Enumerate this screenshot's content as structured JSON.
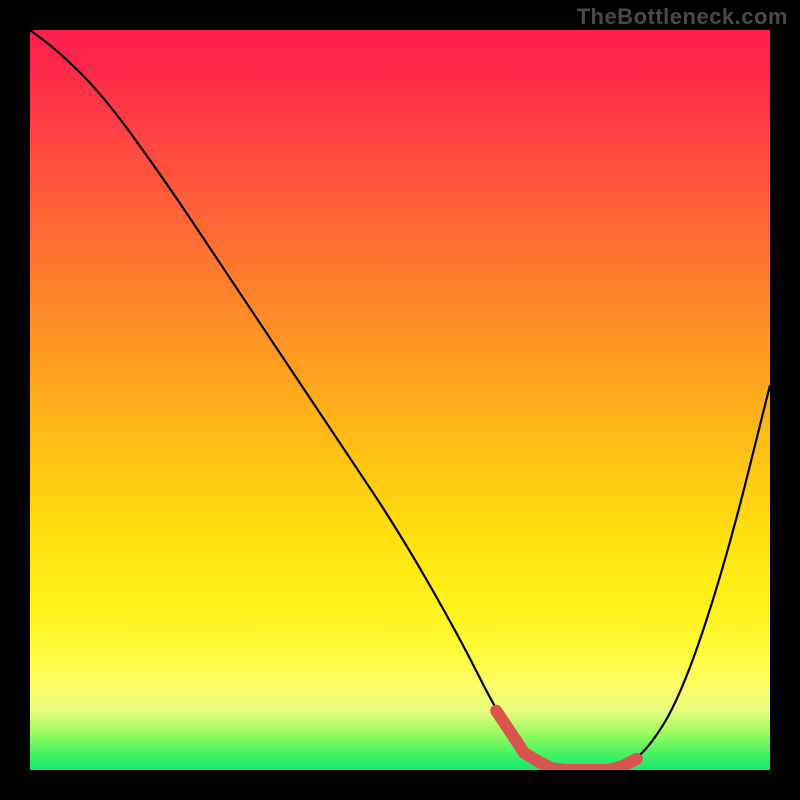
{
  "watermark": "TheBottleneck.com",
  "colors": {
    "background": "#000000",
    "gradient_top": "#ff1e4e",
    "gradient_bottom": "#16e872",
    "curve": "#000000",
    "highlight": "#d9534f"
  },
  "chart_data": {
    "type": "line",
    "title": "",
    "xlabel": "",
    "ylabel": "",
    "xlim": [
      0,
      100
    ],
    "ylim": [
      0,
      100
    ],
    "grid": false,
    "legend": false,
    "x": [
      0,
      4,
      10,
      18,
      26,
      34,
      42,
      50,
      58,
      63,
      67,
      71,
      75,
      79,
      83,
      88,
      94,
      100
    ],
    "values": [
      100,
      97,
      91,
      80,
      68,
      56,
      44,
      32,
      18,
      8,
      2,
      0,
      0,
      0,
      2,
      10,
      28,
      52
    ],
    "highlight_range_x": [
      63,
      82
    ],
    "annotations": []
  }
}
